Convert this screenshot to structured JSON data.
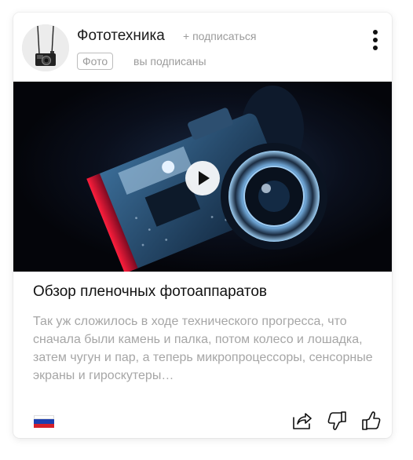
{
  "channel": {
    "name": "Фототехника",
    "subscribe_label": "+ подписаться",
    "category": "Фото",
    "subscription_status": "вы подписаны"
  },
  "article": {
    "title": "Обзор пленочных фотоаппаратов",
    "excerpt": "Так уж сложилось в ходе технического прогресса, что сначала были камень и палка, потом колесо и лошадка, затем чугун и пар, а теперь микропроцессоры, сенсорные экраны и гироскутеры…"
  },
  "icons": {
    "more": "vertical-dots-icon",
    "play": "play-icon",
    "share": "share-icon",
    "dislike": "thumbs-down-icon",
    "like": "thumbs-up-icon",
    "flag": "russia-flag-icon"
  },
  "colors": {
    "text_primary": "#111111",
    "text_muted": "#a6a6a6",
    "flag_white": "#ffffff",
    "flag_blue": "#1c3fb0",
    "flag_red": "#d5202a"
  }
}
